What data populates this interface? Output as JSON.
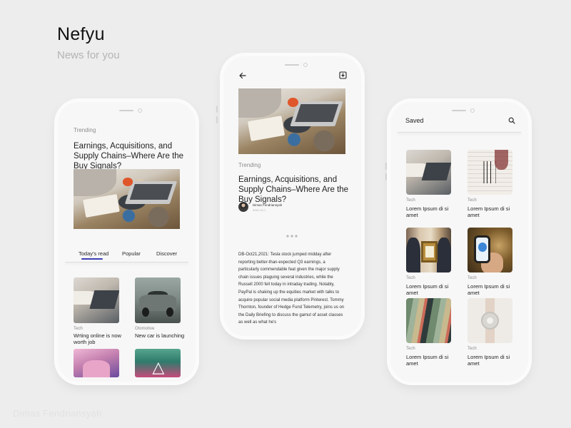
{
  "brand": {
    "title": "Nefyu",
    "subtitle": "News for you",
    "author": "Dimas Fendriansyah"
  },
  "phone1": {
    "kicker": "Trending",
    "headline": "Earnings, Acquisitions, and Supply Chains–Where Are the Buy Signals?",
    "tabs": [
      {
        "label": "Today's read",
        "active": true
      },
      {
        "label": "Popular",
        "active": false
      },
      {
        "label": "Discover",
        "active": false
      }
    ],
    "cards": [
      {
        "category": "Tech",
        "title": "Wrting online is now worth job"
      },
      {
        "category": "Otomotive",
        "title": "New car is launching"
      }
    ]
  },
  "phone2": {
    "kicker": "Trending",
    "headline": "Earnings, Acquisitions, and Supply Chains–Where Are the Buy Signals?",
    "author_name": "Dimas Fendriansyah",
    "date": "2021-10-1",
    "body": "DB-Oct21,2021: Tesla stock jumped midday after reporting better-than-expected Q3 earnings, a particularly commendable feat given the major supply chain issues plaguing several industries, while the Russell 2000 fell today in intraday trading. Notably, PayPal is shaking up the equities market with talks to acquire popular social media platform Pinterest. Tommy Thornton, founder of Hedge Fund Telemetry, joins us on the Daily Briefing to discuss the gamut of asset classes as well as what he's"
  },
  "phone3": {
    "title": "Saved",
    "cards": [
      {
        "category": "Tech",
        "title": "Lorem Ipsum di si amet"
      },
      {
        "category": "Tech",
        "title": "Lorem Ipsum di si amet"
      },
      {
        "category": "Tech",
        "title": "Lorem Ipsum di si amet"
      },
      {
        "category": "Tech",
        "title": "Lorem Ipsum di si amet"
      },
      {
        "category": "Tech",
        "title": "Lorem Ipsum di si amet"
      },
      {
        "category": "Tech",
        "title": "Lorem Ipsum di si amet"
      }
    ]
  },
  "icons": {
    "back": "arrow-left-icon",
    "bookmark": "bookmark-download-icon",
    "search": "search-icon",
    "more": "more-dots-icon"
  },
  "colors": {
    "background": "#ededed",
    "phone": "#f7f7f7",
    "accent": "#3c40b6",
    "muted_text": "#b4b4b4"
  }
}
